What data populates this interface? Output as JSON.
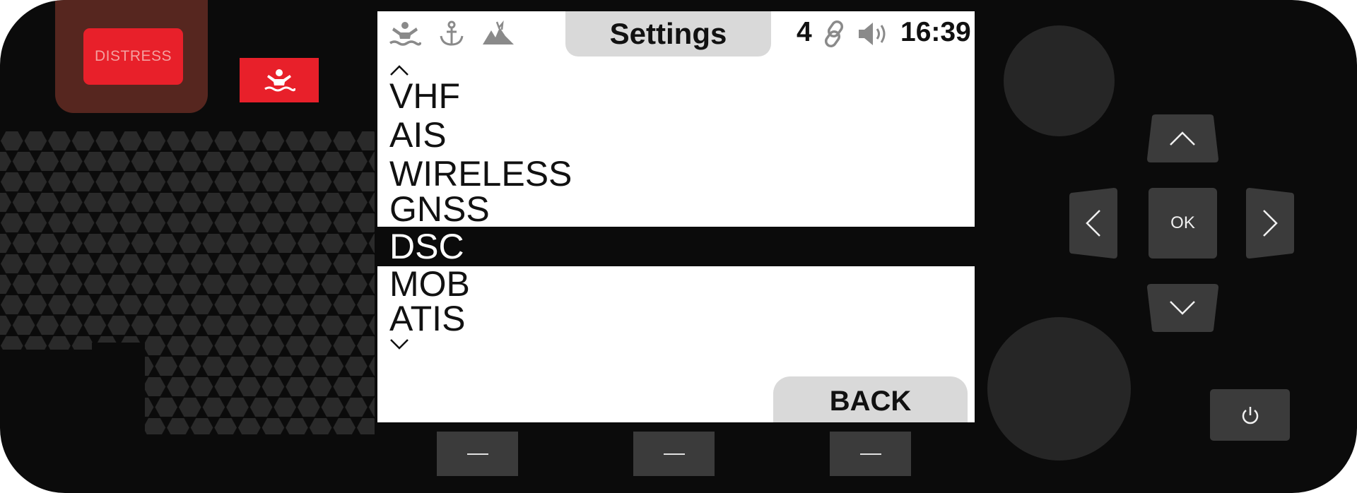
{
  "device": {
    "distress_label": "DISTRESS",
    "mob_icon": "man-overboard-icon"
  },
  "screen": {
    "title": "Settings",
    "status_icons": [
      "man-overboard-icon",
      "anchor-icon",
      "collision-alert-icon",
      "link-icon",
      "speaker-icon"
    ],
    "channel_count": "4",
    "time": "16:39",
    "menu_items": [
      {
        "label": "VHF",
        "selected": false
      },
      {
        "label": "AIS",
        "selected": false
      },
      {
        "label": "WIRELESS",
        "selected": false
      },
      {
        "label": "GNSS",
        "selected": false
      },
      {
        "label": "DSC",
        "selected": true
      },
      {
        "label": "MOB",
        "selected": false
      },
      {
        "label": "ATIS",
        "selected": false
      }
    ],
    "back_label": "BACK"
  },
  "dpad": {
    "ok_label": "OK"
  },
  "colors": {
    "device_body": "#0b0b0b",
    "distress_red": "#e8202a",
    "button_gray": "#3b3b3b",
    "tab_gray": "#d9d9d9",
    "knob": "#262626"
  }
}
